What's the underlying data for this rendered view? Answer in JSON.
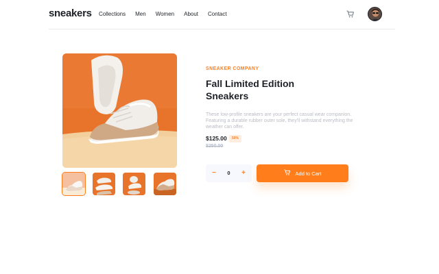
{
  "header": {
    "logo": "sneakers",
    "nav": [
      "Collections",
      "Men",
      "Women",
      "About",
      "Contact"
    ],
    "cart_icon": "cart-icon",
    "avatar": "user-avatar"
  },
  "product": {
    "company": "SNEAKER COMPANY",
    "title_line1": "Fall Limited Edition",
    "title_line2": "Sneakers",
    "description": "These low-profile sneakers are your perfect casual wear companion. Featuring a durable rubber outer sole, they'll withstand everything the weather can offer.",
    "price": "$125.00",
    "discount": "50%",
    "old_price": "$250.00",
    "quantity": "0",
    "minus_symbol": "−",
    "plus_symbol": "+",
    "add_to_cart": "Add to Cart"
  },
  "gallery": {
    "thumbnail_count": 4,
    "active_thumbnail": 1
  },
  "colors": {
    "accent": "#ff7e1b",
    "accent_pale": "#ffede0",
    "text_dark": "#1d2026",
    "text_muted": "#b9bcc4"
  }
}
